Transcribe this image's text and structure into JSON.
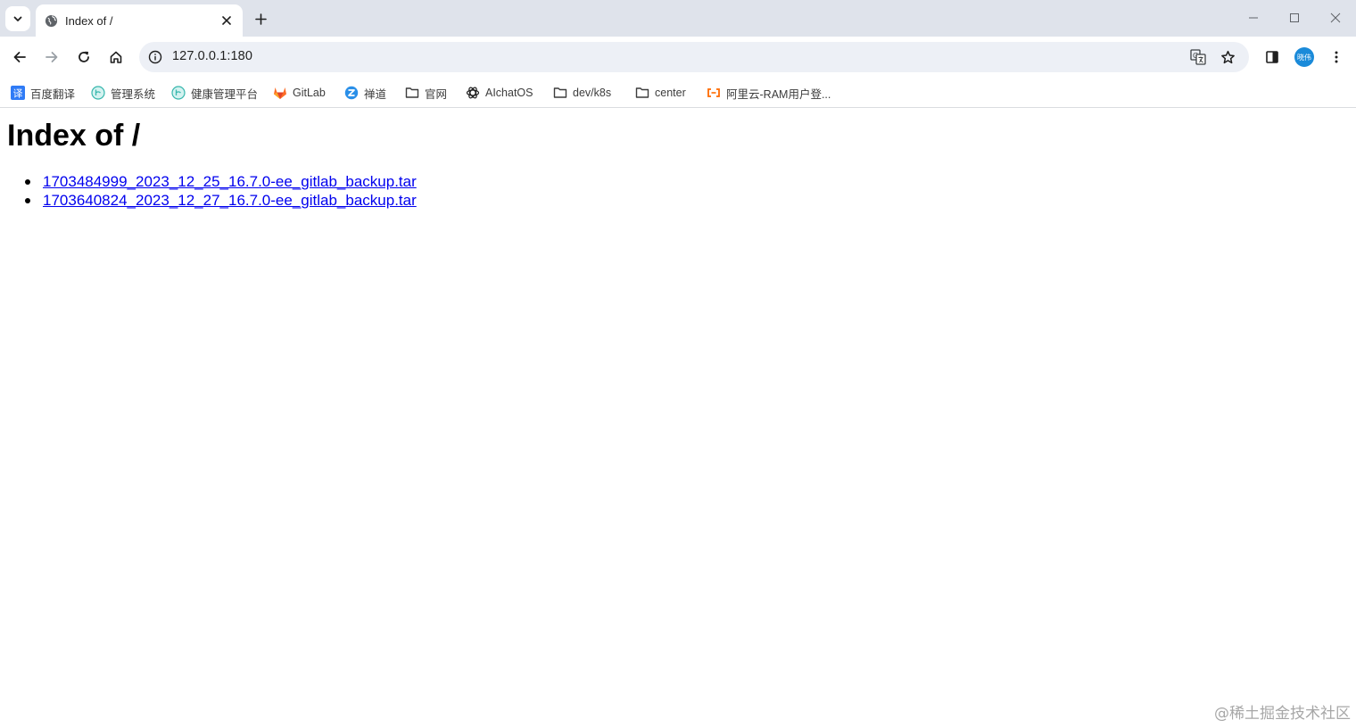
{
  "browser": {
    "tab": {
      "title": "Index of /"
    },
    "address_bar": {
      "url": "127.0.0.1:180"
    },
    "profile_avatar_text": "晓伟",
    "accent_color": "#1a8ad9"
  },
  "bookmarks": [
    {
      "label": "百度翻译",
      "icon": "baidu-translate-icon"
    },
    {
      "label": "管理系统",
      "icon": "site-icon"
    },
    {
      "label": "健康管理平台",
      "icon": "site-icon"
    },
    {
      "label": "GitLab",
      "icon": "gitlab-icon"
    },
    {
      "label": "禅道",
      "icon": "zentao-icon"
    },
    {
      "label": "官网",
      "icon": "folder-icon"
    },
    {
      "label": "AIchatOS",
      "icon": "openai-icon"
    },
    {
      "label": "dev/k8s",
      "icon": "folder-icon"
    },
    {
      "label": "center",
      "icon": "folder-icon"
    },
    {
      "label": "阿里云-RAM用户登...",
      "icon": "aliyun-icon"
    }
  ],
  "page": {
    "heading": "Index of /",
    "files": [
      "1703484999_2023_12_25_16.7.0-ee_gitlab_backup.tar",
      "1703640824_2023_12_27_16.7.0-ee_gitlab_backup.tar"
    ],
    "link_color": "#0000ee"
  },
  "watermark": "@稀土掘金技术社区"
}
